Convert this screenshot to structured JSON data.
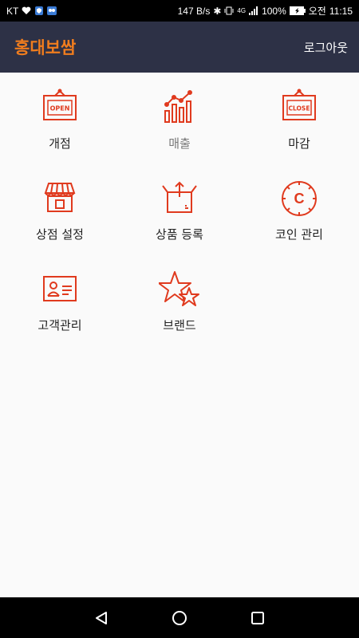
{
  "status_bar": {
    "carrier": "KT",
    "speed": "147 B/s",
    "network": "4G",
    "battery": "100%",
    "ampm": "오전",
    "time": "11:15"
  },
  "header": {
    "title": "홍대보쌈",
    "logout_label": "로그아웃"
  },
  "menu": [
    {
      "label": "개점",
      "icon": "open-sign-icon",
      "sign_text": "OPEN"
    },
    {
      "label": "매출",
      "icon": "sales-chart-icon"
    },
    {
      "label": "마감",
      "icon": "close-sign-icon",
      "sign_text": "CLOSE"
    },
    {
      "label": "상점 설정",
      "icon": "store-icon"
    },
    {
      "label": "상품 등록",
      "icon": "box-upload-icon"
    },
    {
      "label": "코인 관리",
      "icon": "coin-icon",
      "coin_letter": "C"
    },
    {
      "label": "고객관리",
      "icon": "customer-card-icon"
    },
    {
      "label": "브랜드",
      "icon": "stars-icon"
    }
  ],
  "colors": {
    "accent": "#f07d1e",
    "icon": "#e03a1e",
    "app_bar": "#2d3146"
  }
}
